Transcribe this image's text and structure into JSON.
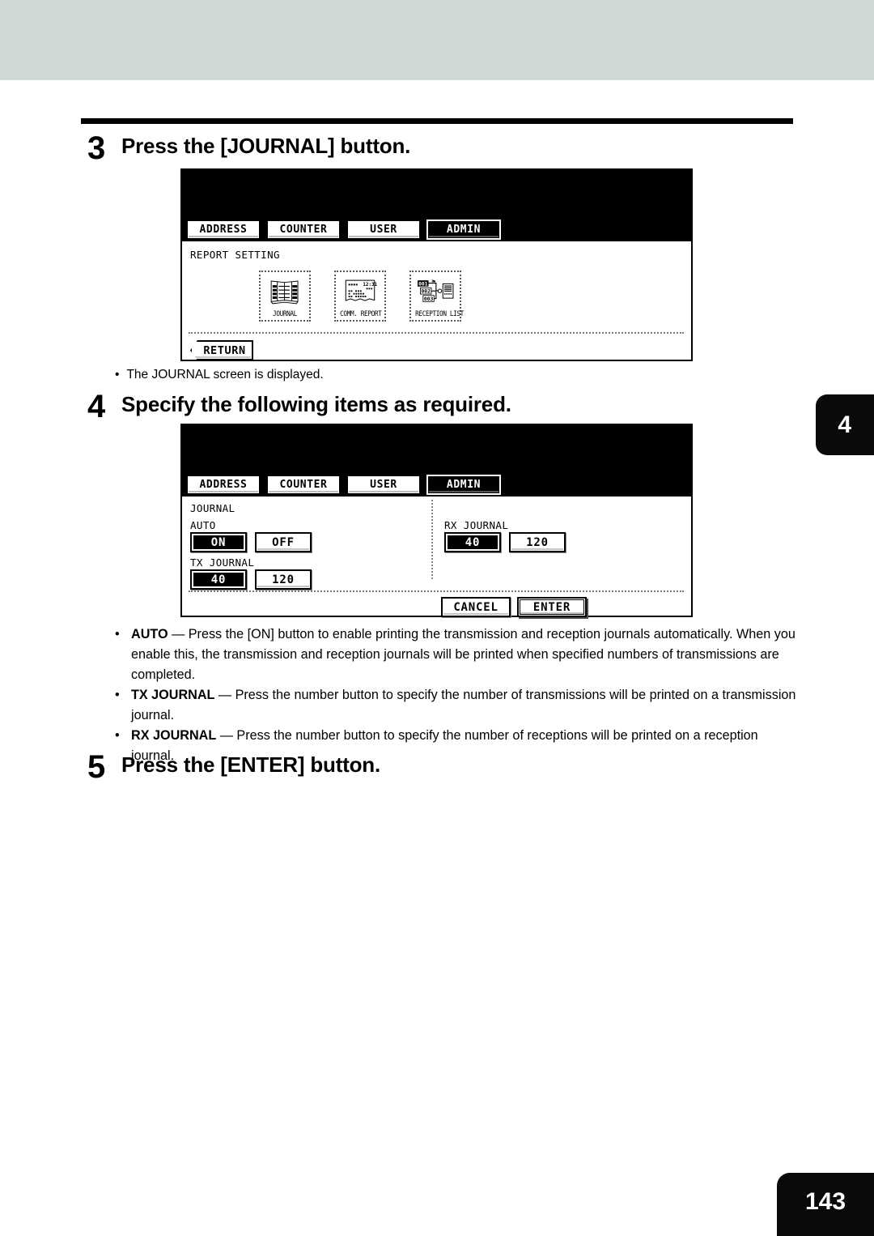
{
  "page": {
    "number": "143",
    "chapter_tab": "4"
  },
  "steps": [
    {
      "num": "3",
      "title": "Press the [JOURNAL] button."
    },
    {
      "num": "4",
      "title": "Specify the following items as required."
    },
    {
      "num": "5",
      "title": "Press the [ENTER] button."
    }
  ],
  "note_journal": {
    "bullet": "•",
    "text": "The JOURNAL screen is displayed."
  },
  "bullets": [
    {
      "marker": "•",
      "term": "AUTO",
      "rest": " — Press the [ON] button to enable printing the transmission and reception journals automatically. When you enable this, the transmission and reception journals will be printed when specified numbers of transmissions are completed."
    },
    {
      "marker": "•",
      "term": "TX JOURNAL",
      "rest": " — Press the number button to specify the number of transmissions will be printed on a transmission journal."
    },
    {
      "marker": "•",
      "term": "RX JOURNAL",
      "rest": " — Press the number button to specify the number of receptions will be printed on a reception journal."
    }
  ],
  "lcd_report": {
    "tabs": [
      {
        "label": "ADDRESS",
        "selected": false
      },
      {
        "label": "COUNTER",
        "selected": false
      },
      {
        "label": "USER",
        "selected": false
      },
      {
        "label": "ADMIN",
        "selected": true
      }
    ],
    "screen_title": "REPORT SETTING",
    "icons": [
      {
        "caption": "JOURNAL",
        "glyph": "journal-book-icon"
      },
      {
        "caption": "COMM. REPORT",
        "glyph": "comm-report-page-icon"
      },
      {
        "caption": "RECEPTION LIST",
        "glyph": "reception-list-icon"
      }
    ],
    "return_button": "RETURN"
  },
  "lcd_journal": {
    "tabs": [
      {
        "label": "ADDRESS",
        "selected": false
      },
      {
        "label": "COUNTER",
        "selected": false
      },
      {
        "label": "USER",
        "selected": false
      },
      {
        "label": "ADMIN",
        "selected": true
      }
    ],
    "screen_title": "JOURNAL",
    "groups": {
      "auto": {
        "label": "AUTO",
        "options": [
          {
            "label": "ON",
            "selected": true
          },
          {
            "label": "OFF",
            "selected": false
          }
        ]
      },
      "tx_journal": {
        "label": "TX JOURNAL",
        "options": [
          {
            "label": "40",
            "selected": true
          },
          {
            "label": "120",
            "selected": false
          }
        ]
      },
      "rx_journal": {
        "label": "RX JOURNAL",
        "options": [
          {
            "label": "40",
            "selected": true
          },
          {
            "label": "120",
            "selected": false
          }
        ]
      }
    },
    "cancel_button": "CANCEL",
    "enter_button": "ENTER"
  },
  "colors": {
    "header_band": "#cfd8d6",
    "ink": "#000000",
    "page_tab_bg": "#0a0a0a"
  }
}
